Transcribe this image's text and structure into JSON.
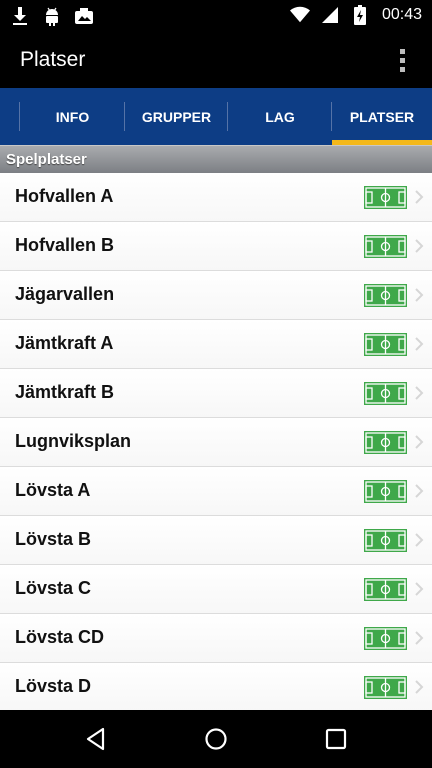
{
  "status_bar": {
    "time": "00:43",
    "icons_left": [
      "download-icon",
      "android-icon",
      "photo-icon"
    ],
    "icons_right": [
      "wifi-icon",
      "signal-icon",
      "battery-icon"
    ]
  },
  "app_bar": {
    "title": "Platser"
  },
  "tabs": [
    {
      "label": "",
      "active": false
    },
    {
      "label": "INFO",
      "active": false
    },
    {
      "label": "GRUPPER",
      "active": false
    },
    {
      "label": "LAG",
      "active": false
    },
    {
      "label": "PLATSER",
      "active": true
    }
  ],
  "section": {
    "title": "Spelplatser"
  },
  "venues": [
    {
      "name": "Hofvallen A"
    },
    {
      "name": "Hofvallen B"
    },
    {
      "name": "Jägarvallen"
    },
    {
      "name": "Jämtkraft A"
    },
    {
      "name": "Jämtkraft B"
    },
    {
      "name": "Lugnviksplan"
    },
    {
      "name": "Lövsta A"
    },
    {
      "name": "Lövsta B"
    },
    {
      "name": "Lövsta C"
    },
    {
      "name": "Lövsta CD"
    },
    {
      "name": "Lövsta D"
    }
  ],
  "colors": {
    "tab_bar": "#0d3d85",
    "tab_indicator": "#f3b81b",
    "field_icon": "#3fa84a"
  },
  "nav_bar": {
    "buttons": [
      "back-icon",
      "home-icon",
      "recents-icon"
    ]
  }
}
